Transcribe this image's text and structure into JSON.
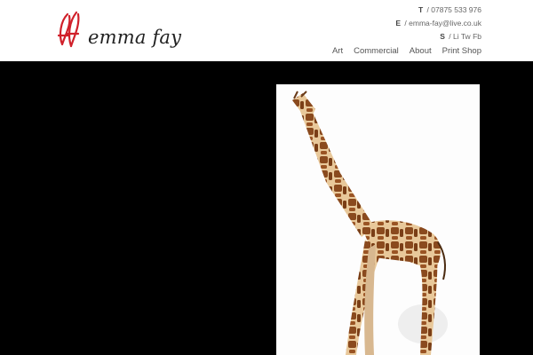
{
  "site": {
    "logo_text": "emma fay",
    "logo_mark": "ef"
  },
  "contact": {
    "phone_key": "T",
    "phone": "07875 533 976",
    "email_key": "E",
    "email": "emma-fay@live.co.uk",
    "social_key": "S",
    "social_links": [
      "Li",
      "Tw",
      "Fb"
    ]
  },
  "nav": {
    "items": [
      {
        "label": "Art"
      },
      {
        "label": "Commercial"
      },
      {
        "label": "About"
      },
      {
        "label": "Print Shop"
      }
    ]
  },
  "colors": {
    "accent": "#d0202a",
    "header_bg": "#ffffff",
    "page_bg": "#000000"
  },
  "artwork": {
    "subject": "giraffe"
  }
}
